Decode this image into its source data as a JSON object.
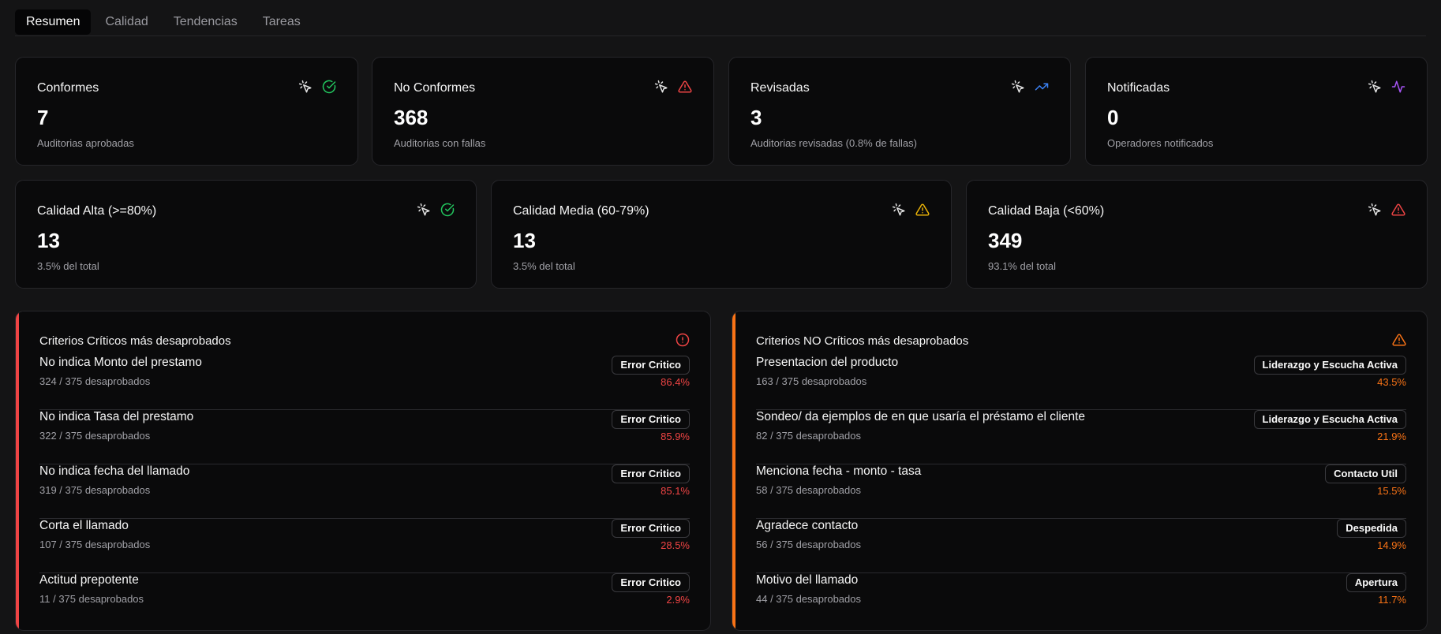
{
  "tabs": [
    {
      "label": "Resumen",
      "active": true
    },
    {
      "label": "Calidad"
    },
    {
      "label": "Tendencias"
    },
    {
      "label": "Tareas"
    }
  ],
  "stats_top": [
    {
      "title": "Conformes",
      "value": "7",
      "sub": "Auditorias aprobadas",
      "icon": "check-circle-icon",
      "color": "#22c55e"
    },
    {
      "title": "No Conformes",
      "value": "368",
      "sub": "Auditorias con fallas",
      "icon": "alert-triangle-icon",
      "color": "#ef4444"
    },
    {
      "title": "Revisadas",
      "value": "3",
      "sub": "Auditorias revisadas (0.8% de fallas)",
      "icon": "trending-up-icon",
      "color": "#3b82f6"
    },
    {
      "title": "Notificadas",
      "value": "0",
      "sub": "Operadores notificados",
      "icon": "activity-icon",
      "color": "#a855f7"
    }
  ],
  "stats_quality": [
    {
      "title": "Calidad Alta (>=80%)",
      "value": "13",
      "sub": "3.5% del total",
      "icon": "check-circle-icon",
      "color": "#22c55e"
    },
    {
      "title": "Calidad Media (60-79%)",
      "value": "13",
      "sub": "3.5% del total",
      "icon": "alert-triangle-icon",
      "color": "#eab308"
    },
    {
      "title": "Calidad Baja (<60%)",
      "value": "349",
      "sub": "93.1% del total",
      "icon": "alert-triangle-icon",
      "color": "#ef4444"
    }
  ],
  "critical": {
    "title": "Criterios Críticos más desaprobados",
    "accent": "#ef4444",
    "icon": "alert-circle-icon",
    "rows": [
      {
        "name": "No indica Monto del prestamo",
        "count": "324 / 375 desaprobados",
        "badge": "Error Critico",
        "pct": "86.4%"
      },
      {
        "name": "No indica Tasa del prestamo",
        "count": "322 / 375 desaprobados",
        "badge": "Error Critico",
        "pct": "85.9%"
      },
      {
        "name": "No indica fecha del llamado",
        "count": "319 / 375 desaprobados",
        "badge": "Error Critico",
        "pct": "85.1%"
      },
      {
        "name": "Corta el llamado",
        "count": "107 / 375 desaprobados",
        "badge": "Error Critico",
        "pct": "28.5%"
      },
      {
        "name": "Actitud prepotente",
        "count": "11 / 375 desaprobados",
        "badge": "Error Critico",
        "pct": "2.9%"
      }
    ]
  },
  "noncritical": {
    "title": "Criterios NO Críticos más desaprobados",
    "accent": "#f97316",
    "icon": "alert-triangle-icon",
    "rows": [
      {
        "name": "Presentacion del producto",
        "count": "163 / 375 desaprobados",
        "badge": "Liderazgo y Escucha Activa",
        "pct": "43.5%"
      },
      {
        "name": "Sondeo/ da ejemplos de en que usaría el préstamo el cliente",
        "count": "82 / 375 desaprobados",
        "badge": "Liderazgo y Escucha Activa",
        "pct": "21.9%"
      },
      {
        "name": "Menciona fecha - monto - tasa",
        "count": "58 / 375 desaprobados",
        "badge": "Contacto Util",
        "pct": "15.5%"
      },
      {
        "name": "Agradece contacto",
        "count": "56 / 375 desaprobados",
        "badge": "Despedida",
        "pct": "14.9%"
      },
      {
        "name": "Motivo del llamado",
        "count": "44 / 375 desaprobados",
        "badge": "Apertura",
        "pct": "11.7%"
      }
    ]
  }
}
